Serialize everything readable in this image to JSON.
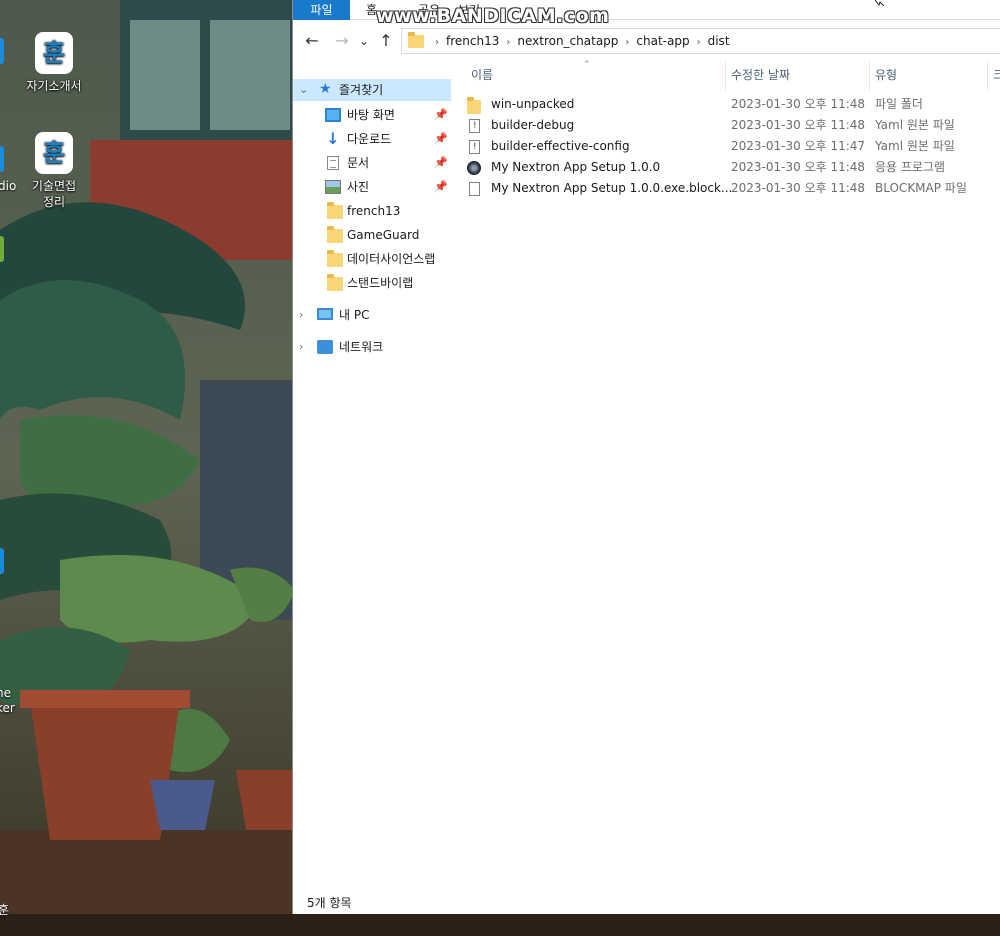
{
  "watermark": "www.BANDICAM.com",
  "desktop": {
    "icons": [
      {
        "glyph": "훈",
        "label": "자기소개서"
      },
      {
        "glyph": "훈",
        "label": "기술면접\n정리"
      }
    ],
    "fragments": [
      "dio",
      "ne",
      "ker",
      "훈"
    ]
  },
  "explorer": {
    "ribbon_tabs": [
      "파일",
      "홈",
      "공유",
      "보기"
    ],
    "nav": {
      "back": "←",
      "forward": "→",
      "recent": "⌄",
      "up": "↑"
    },
    "breadcrumb": [
      "french13",
      "nextron_chatapp",
      "chat-app",
      "dist"
    ],
    "breadcrumb_separator": "›",
    "quick_access": {
      "label": "즐겨찾기",
      "items": [
        {
          "label": "바탕 화면",
          "icon": "desktop-icon",
          "pinned": true
        },
        {
          "label": "다운로드",
          "icon": "download-icon",
          "pinned": true
        },
        {
          "label": "문서",
          "icon": "document-icon",
          "pinned": true
        },
        {
          "label": "사진",
          "icon": "picture-icon",
          "pinned": true
        },
        {
          "label": "french13",
          "icon": "folder-icon",
          "pinned": false
        },
        {
          "label": "GameGuard",
          "icon": "folder-icon",
          "pinned": false
        },
        {
          "label": "데이터사이언스랩",
          "icon": "folder-icon",
          "pinned": false
        },
        {
          "label": "스탠드바이랩",
          "icon": "folder-icon",
          "pinned": false
        }
      ]
    },
    "this_pc": "내 PC",
    "network": "네트워크",
    "columns": {
      "name": "이름",
      "date": "수정한 날짜",
      "type": "유형",
      "size": "크"
    },
    "files": [
      {
        "name": "win-unpacked",
        "date": "2023-01-30 오후 11:48",
        "type": "파일 폴더",
        "icon": "folder-icon"
      },
      {
        "name": "builder-debug",
        "date": "2023-01-30 오후 11:48",
        "type": "Yaml 원본 파일",
        "icon": "yaml-file-icon"
      },
      {
        "name": "builder-effective-config",
        "date": "2023-01-30 오후 11:47",
        "type": "Yaml 원본 파일",
        "icon": "yaml-file-icon"
      },
      {
        "name": "My Nextron App Setup 1.0.0",
        "date": "2023-01-30 오후 11:48",
        "type": "응용 프로그램",
        "icon": "application-icon"
      },
      {
        "name": "My Nextron App Setup 1.0.0.exe.block...",
        "date": "2023-01-30 오후 11:48",
        "type": "BLOCKMAP 파일",
        "icon": "blockmap-file-icon"
      }
    ],
    "status": "5개 항목",
    "colors": {
      "accent": "#1979ca",
      "selection": "#cce8ff"
    }
  }
}
